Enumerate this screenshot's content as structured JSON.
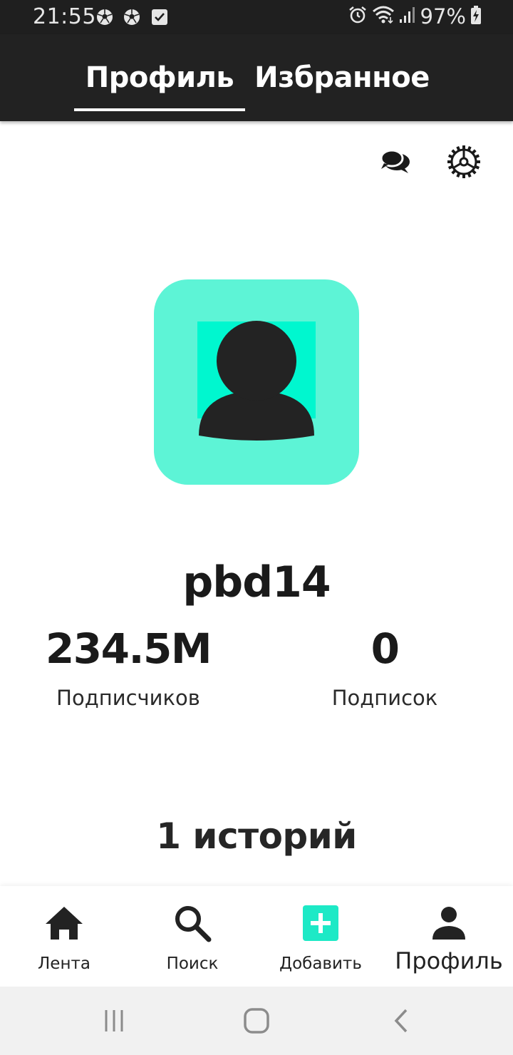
{
  "status_bar": {
    "time": "21:55",
    "battery": "97%",
    "left_icons": [
      "soccer-ball-icon",
      "soccer-ball-icon",
      "checkbox-notification-icon"
    ],
    "right_icons": [
      "alarm-icon",
      "wifi-icon",
      "signal-icon",
      "battery-charging-icon"
    ]
  },
  "tabs": [
    {
      "label": "Профиль",
      "active": true
    },
    {
      "label": "Избранное",
      "active": false
    }
  ],
  "actions": {
    "icons": [
      "chat-icon",
      "settings-icon"
    ]
  },
  "profile": {
    "username": "pbd14",
    "avatar_bg_color": "#5df4d6",
    "followers": {
      "value": "234.5M",
      "label": "Подписчиков"
    },
    "following": {
      "value": "0",
      "label": "Подписок"
    },
    "stories_label": "1 историй"
  },
  "bottom_nav": [
    {
      "label": "Лента",
      "icon": "home-icon",
      "active": false
    },
    {
      "label": "Поиск",
      "icon": "search-icon",
      "active": false
    },
    {
      "label": "Добавить",
      "icon": "add-icon",
      "active": false,
      "accent": "#1de9c6"
    },
    {
      "label": "Профиль",
      "icon": "person-icon",
      "active": true
    }
  ],
  "system_nav": [
    "recents-icon",
    "home-button-icon",
    "back-icon"
  ]
}
